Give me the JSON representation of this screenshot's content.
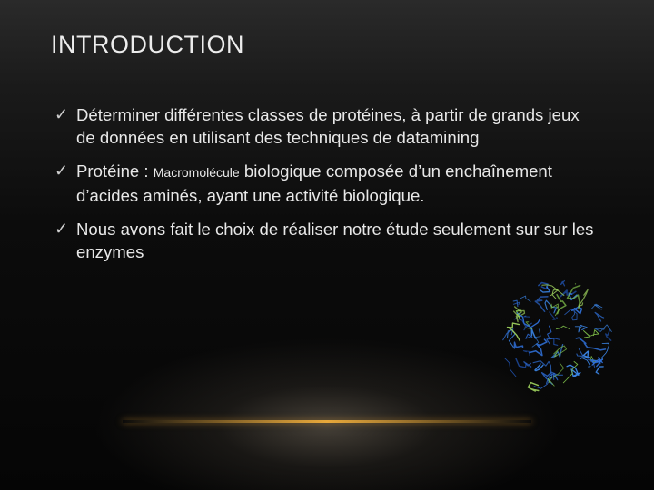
{
  "slide": {
    "title": "INTRODUCTION",
    "bullets": [
      {
        "text": "Déterminer différentes classes de protéines, à partir de grands jeux de données en utilisant des techniques de datamining"
      },
      {
        "prefix": "Protéine : ",
        "small": "Macromolécule",
        "suffix": " biologique composée d’un enchaînement d’acides aminés, ayant une activité biologique."
      },
      {
        "text": "Nous avons fait le choix de réaliser notre étude seulement sur sur les enzymes"
      }
    ],
    "bullet_icon": "checkmark-icon",
    "image": "protein-structure-image"
  },
  "colors": {
    "accent_line": "#e8a83a",
    "text": "#e8e8e8",
    "protein_blue": "#2f6fd6",
    "protein_green": "#7fbf4a"
  }
}
